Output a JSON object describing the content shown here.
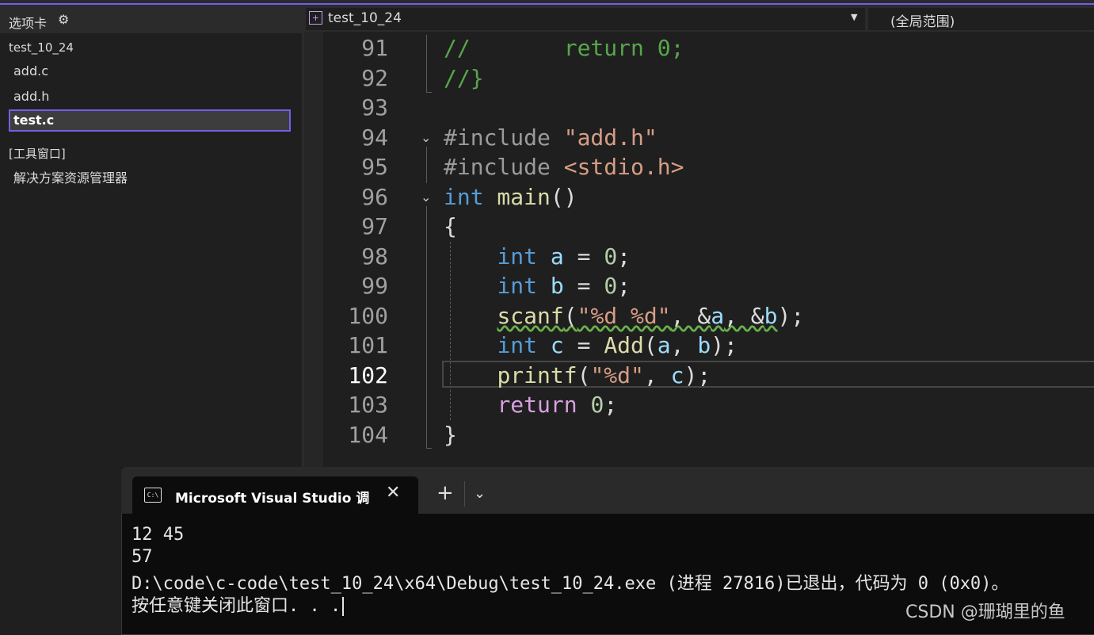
{
  "panel": {
    "title": "选项卡",
    "group": "test_10_24",
    "files": [
      "add.c",
      "add.h",
      "test.c"
    ],
    "selected_file": "test.c",
    "tool_group": "[工具窗口]",
    "tool_item": "解决方案资源管理器"
  },
  "editor": {
    "file_dropdown": "test_10_24",
    "scope_dropdown": "(全局范围)",
    "line_numbers": [
      "91",
      "92",
      "93",
      "94",
      "95",
      "96",
      "97",
      "98",
      "99",
      "100",
      "101",
      "102",
      "103",
      "104"
    ],
    "current_line": "102",
    "lines": {
      "l91a": "//       ",
      "l91b": "return 0;",
      "l92": "//}",
      "l94a": "#include ",
      "l94b": "\"add.h\"",
      "l95a": "#include ",
      "l95b": "<stdio.h>",
      "l96a": "int",
      "l96b": " main",
      "l96c": "()",
      "l97": "{",
      "l98a": "int",
      "l98b": "a",
      "l98c": "0",
      "l99a": "int",
      "l99b": "b",
      "l99c": "0",
      "l100a": "scanf",
      "l100b": "(",
      "l100c": "\"%d %d\"",
      "l100d": ", &",
      "l100e": "a",
      "l100f": ", &",
      "l100g": "b",
      "l100h": ");",
      "l101a": "int",
      "l101b": "c",
      "l101c": "Add",
      "l101d": "a",
      "l101e": "b",
      "l102a": "printf",
      "l102b": "\"%d\"",
      "l102c": "c",
      "l103a": "return",
      "l103b": "0",
      "l104": "}"
    }
  },
  "terminal": {
    "tab_title": "Microsoft Visual Studio 调试控制台",
    "lines": [
      "12 45",
      "57",
      "D:\\code\\c-code\\test_10_24\\x64\\Debug\\test_10_24.exe (进程 27816)已退出，代码为 0 (0x0)。",
      "按任意键关闭此窗口. . ."
    ]
  },
  "watermark": "CSDN @珊瑚里的鱼"
}
